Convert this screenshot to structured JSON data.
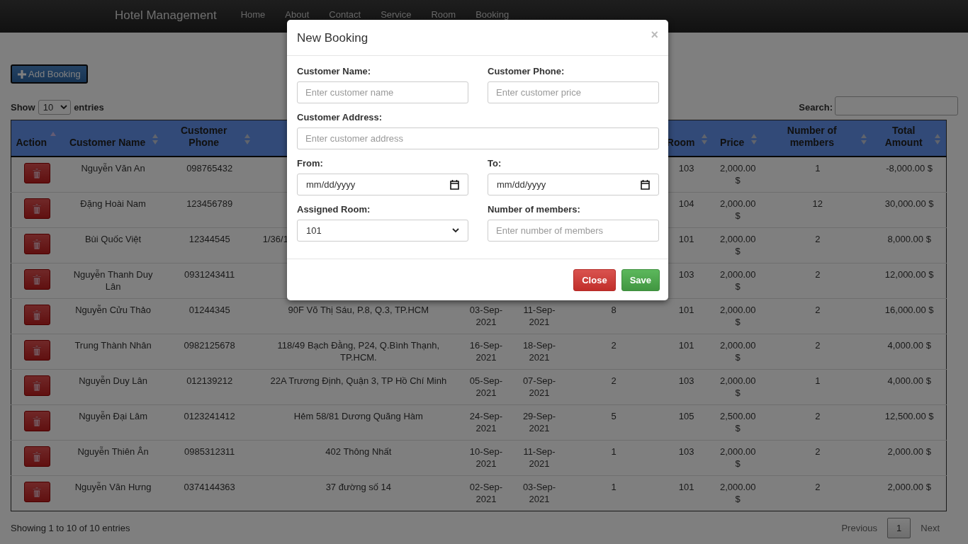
{
  "navbar": {
    "brand": "Hotel Management",
    "links": [
      {
        "label": "Home"
      },
      {
        "label": "About"
      },
      {
        "label": "Contact"
      },
      {
        "label": "Service"
      },
      {
        "label": "Room"
      },
      {
        "label": "Booking"
      }
    ]
  },
  "add_button": {
    "label": "Add Booking"
  },
  "length_control": {
    "before": "Show",
    "value": "10",
    "after": "entries"
  },
  "search": {
    "label": "Search:"
  },
  "table": {
    "columns_left": [
      {
        "label": "Action",
        "sorted": true
      },
      {
        "label": "Customer Name",
        "sorted": false
      },
      {
        "label": "Customer Phone",
        "sorted": false
      }
    ],
    "columns_right": [
      {
        "label": "Room",
        "sorted": false
      },
      {
        "label": "Price",
        "sorted": false
      },
      {
        "label": "Number of members",
        "sorted": false
      },
      {
        "label": "Total Amount",
        "sorted": false
      }
    ],
    "rows": [
      {
        "name": "Nguyễn Văn An",
        "phone": "098765432",
        "room": "103",
        "price": "2,000.00 $",
        "members": "1",
        "total": "-8,000.00 $"
      },
      {
        "name": "Đặng Hoài Nam",
        "phone": "123456789",
        "room": "104",
        "price": "2,000.00 $",
        "members": "12",
        "total": "30,000.00 $"
      },
      {
        "name": "Bùi Quốc Việt",
        "phone": "12344545",
        "address": "1/36/1",
        "address_cut": true,
        "room": "101",
        "price": "2,000.00 $",
        "members": "2",
        "total": "8,000.00 $"
      },
      {
        "name": "Nguyễn Thanh Duy Lân",
        "phone": "0931243411",
        "room": "103",
        "price": "2,000.00 $",
        "members": "2",
        "total": "12,000.00 $"
      },
      {
        "name": "Nguyễn Cửu Thảo",
        "phone": "01244345",
        "address": "90F Võ Thị Sáu, P.8, Q.3, TP.HCM",
        "from": "03-Sep-2021",
        "to": "11-Sep-2021",
        "column_6": "8",
        "room": "101",
        "price": "2,000.00 $",
        "members": "2",
        "total": "16,000.00 $"
      },
      {
        "name": "Trung Thành Nhân",
        "phone": "0982125678",
        "address": "118/49 Bạch Đằng, P24, Q.Bình Thạnh, TP.HCM.",
        "from": "16-Sep-2021",
        "to": "18-Sep-2021",
        "column_6": "2",
        "room": "101",
        "price": "2,000.00 $",
        "members": "2",
        "total": "4,000.00 $"
      },
      {
        "name": "Nguyễn Duy Lân",
        "phone": "012139212",
        "address": "22A Trương Định, Quận 3, TP Hồ Chí Minh",
        "from": "05-Sep-2021",
        "to": "07-Sep-2021",
        "column_6": "2",
        "room": "103",
        "price": "2,000.00 $",
        "members": "1",
        "total": "4,000.00 $"
      },
      {
        "name": "Nguyễn Đại Lâm",
        "phone": "0123241412",
        "address": "Hẻm 58/81 Dương Quãng Hàm",
        "from": "24-Sep-2021",
        "to": "29-Sep-2021",
        "column_6": "5",
        "room": "105",
        "price": "2,500.00 $",
        "members": "2",
        "total": "12,500.00 $"
      },
      {
        "name": "Nguyễn Thiên Ân",
        "phone": "0985312311",
        "address": "402 Thông Nhất",
        "from": "10-Sep-2021",
        "to": "11-Sep-2021",
        "column_6": "1",
        "room": "103",
        "price": "2,000.00 $",
        "members": "2",
        "total": "2,000.00 $"
      },
      {
        "name": "Nguyễn Văn Hưng",
        "phone": "0374144363",
        "address": "37 đường số 14",
        "from": "02-Sep-2021",
        "to": "03-Sep-2021",
        "column_6": "1",
        "room": "101",
        "price": "2,000.00 $",
        "members": "2",
        "total": "2,000.00 $"
      }
    ]
  },
  "info": "Showing 1 to 10 of 10 entries",
  "pagination": {
    "previous": "Previous",
    "pages": [
      {
        "label": "1",
        "selected": true
      }
    ],
    "next": "Next"
  },
  "modal": {
    "title": "New Booking",
    "close_glyph": "×",
    "fields": [
      {
        "kind": "text",
        "label": "Customer Name:",
        "placeholder": "Enter customer name",
        "wide": false
      },
      {
        "kind": "text",
        "label": "Customer Phone:",
        "placeholder": "Enter customer price",
        "wide": false
      },
      {
        "kind": "text",
        "label": "Customer Address:",
        "placeholder": "Enter customer address",
        "wide": true
      },
      {
        "kind": "date",
        "label": "From:",
        "placeholder": "mm/dd/yyyy",
        "wide": false
      },
      {
        "kind": "date",
        "label": "To:",
        "placeholder": "mm/dd/yyyy",
        "wide": false
      },
      {
        "kind": "select",
        "label": "Assigned Room:",
        "value": "101",
        "wide": false
      },
      {
        "kind": "text",
        "label": "Number of members:",
        "placeholder": "Enter number of members",
        "wide": false
      }
    ],
    "buttons": [
      {
        "kind": "danger",
        "label": "Close"
      },
      {
        "kind": "success",
        "label": "Save"
      }
    ]
  }
}
